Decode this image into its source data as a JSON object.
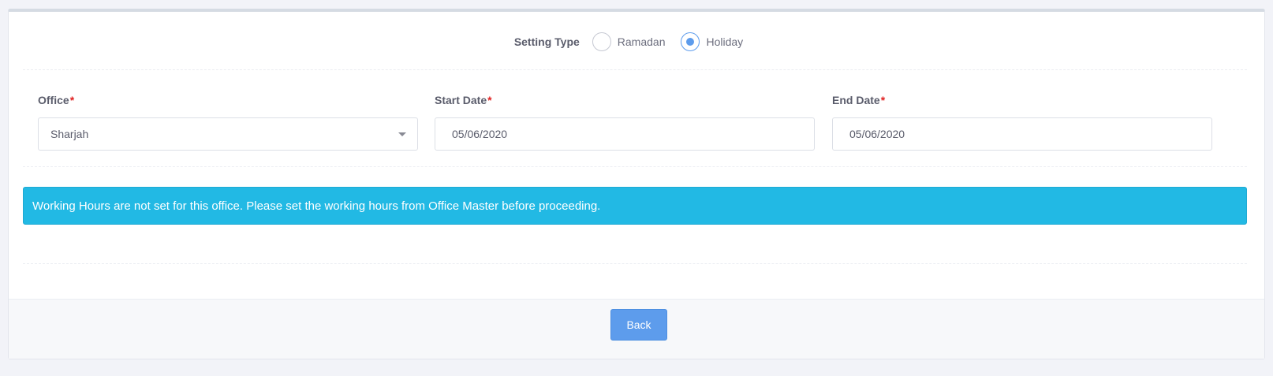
{
  "setting_type": {
    "label": "Setting Type",
    "options": [
      {
        "label": "Ramadan",
        "selected": false
      },
      {
        "label": "Holiday",
        "selected": true
      }
    ]
  },
  "form": {
    "office": {
      "label": "Office",
      "required_mark": "*",
      "value": "Sharjah"
    },
    "start_date": {
      "label": "Start Date",
      "required_mark": "*",
      "value": "05/06/2020"
    },
    "end_date": {
      "label": "End Date",
      "required_mark": "*",
      "value": "05/06/2020"
    }
  },
  "alert": {
    "message": "Working Hours are not set for this office. Please set the working hours from Office Master before proceeding.",
    "color": "#22b9e4"
  },
  "footer": {
    "back_label": "Back",
    "button_color": "#5d9cec"
  },
  "icons": {
    "dropdown": "chevron-down-icon"
  }
}
